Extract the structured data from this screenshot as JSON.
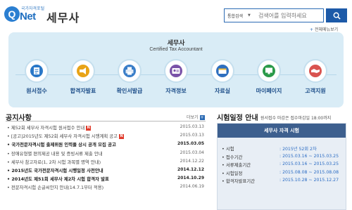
{
  "header": {
    "logo_tag": "국가자격포털",
    "logo_letter": "Q",
    "logo_text": "Net",
    "site_title": "세무사",
    "search_scope": "통합검색",
    "search_placeholder": "검색어를 입력하세요",
    "all_menu": "전체메뉴보기"
  },
  "banner": {
    "title": "세무사",
    "subtitle": "Certified Tax Accountant",
    "menu": [
      {
        "label": "원서접수",
        "icon": "document-icon",
        "color": "#2a78c8"
      },
      {
        "label": "합격자발표",
        "icon": "megaphone-icon",
        "color": "#e8a317"
      },
      {
        "label": "확인서발급",
        "icon": "printer-icon",
        "color": "#3a7ec8"
      },
      {
        "label": "자격정보",
        "icon": "id-card-icon",
        "color": "#7a52a8"
      },
      {
        "label": "자료실",
        "icon": "folder-icon",
        "color": "#2e6fbf"
      },
      {
        "label": "마이페이지",
        "icon": "monitor-icon",
        "color": "#2b9a4a"
      },
      {
        "label": "고객지원",
        "icon": "handshake-icon",
        "color": "#d9534f"
      }
    ]
  },
  "notices": {
    "heading": "공지사항",
    "more": "더보기",
    "items": [
      {
        "title": "제52회 세무사 자격시험 원서접수 안내",
        "date": "2015.03.13",
        "bold": false,
        "new": true
      },
      {
        "title": "[공고]2015년도 제52회 세무사 자격시험 시행계획 공고",
        "date": "2015.03.13",
        "bold": false,
        "new": true
      },
      {
        "title": "국가전문자격시험 출제위원 인력풀 상시 공개 모집 공고",
        "date": "2015.03.05",
        "bold": true,
        "new": false
      },
      {
        "title": "장애유형별 편의제공 내용 및 증빙서류 제출 안내",
        "date": "2015.03.04",
        "bold": false,
        "new": false
      },
      {
        "title": "세무사 참고자료(1, 2차 시험 과목별 명역 안내)",
        "date": "2014.12.22",
        "bold": false,
        "new": false
      },
      {
        "title": "2015년도 국가전문자격시험 시행일정 사전안내",
        "date": "2014.12.12",
        "bold": true,
        "new": false
      },
      {
        "title": "2014년도 제51회 세무사 제2차 시험 합격자 발표",
        "date": "2014.10.29",
        "bold": true,
        "new": false
      },
      {
        "title": "전문자격시험 손글씨안지 안내(14.7.1부터 적용)",
        "date": "2014.06.19",
        "bold": false,
        "new": false
      }
    ]
  },
  "schedule": {
    "heading": "시험일정 안내",
    "note": "원서접수 마감은 접수마감일 18:00까지",
    "box_title": "세무사 자격 시험",
    "rows": [
      {
        "label": "시험",
        "value": "2015년 52회 2차"
      },
      {
        "label": "접수기간",
        "value": "2015.03.16 ~ 2015.03.25"
      },
      {
        "label": "서류제출기간",
        "value": "2015.03.16 ~ 2015.03.25"
      },
      {
        "label": "시험일정",
        "value": "2015.08.08 ~ 2015.08.08"
      },
      {
        "label": "합격자발표기간",
        "value": "2015.10.28 ~ 2015.12.27"
      }
    ]
  }
}
